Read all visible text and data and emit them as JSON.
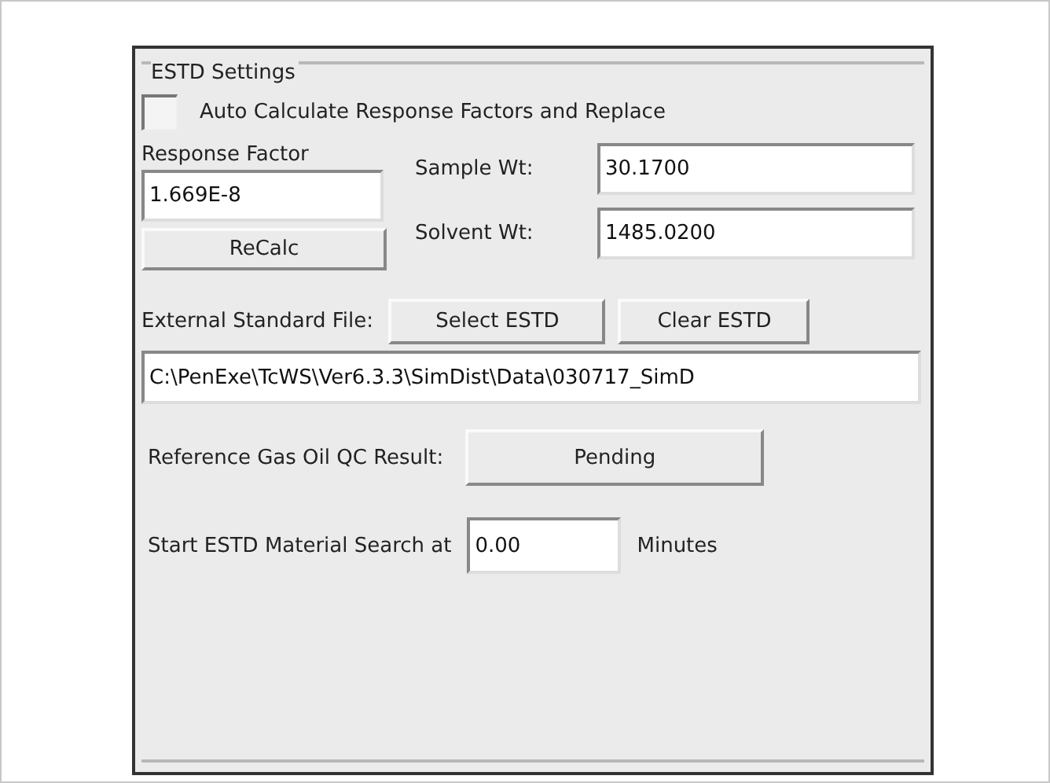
{
  "group": {
    "title": "ESTD Settings"
  },
  "auto_calculate": {
    "label": "Auto Calculate Response Factors and Replace",
    "checked": false
  },
  "response_factor": {
    "label": "Response Factor",
    "value": "1.669E-8",
    "button": "ReCalc"
  },
  "sample_wt": {
    "label": "Sample Wt:",
    "value": "30.1700"
  },
  "solvent_wt": {
    "label": "Solvent Wt:",
    "value": "1485.0200"
  },
  "external_standard": {
    "label": "External Standard File:",
    "buttons": [
      "Select ESTD",
      "Clear ESTD"
    ],
    "path": "C:\\PenExe\\TcWS\\Ver6.3.3\\SimDist\\Data\\030717_SimD"
  },
  "qc_result": {
    "label": "Reference Gas Oil QC Result:",
    "value": "Pending"
  },
  "search_start": {
    "label": "Start ESTD Material Search at",
    "value": "0.00",
    "unit": "Minutes"
  }
}
